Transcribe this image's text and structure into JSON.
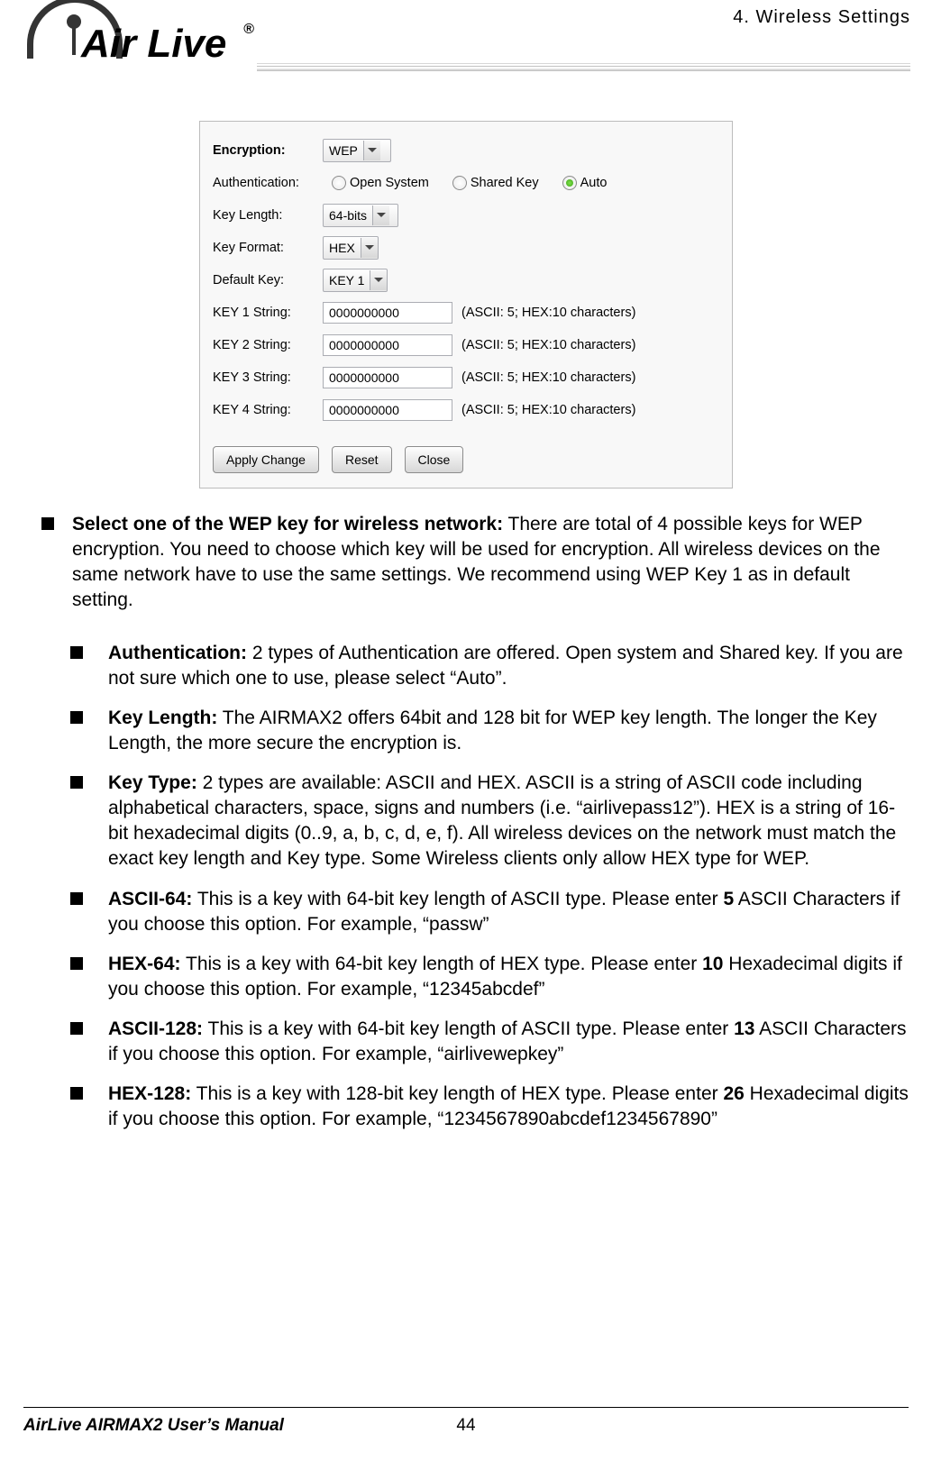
{
  "header": {
    "chapter": "4.  Wireless  Settings",
    "brand": "Air Live",
    "reg": "®"
  },
  "panel": {
    "encryption_label": "Encryption:",
    "encryption_value": "WEP",
    "auth_label": "Authentication:",
    "auth_open": "Open System",
    "auth_shared": "Shared Key",
    "auth_auto": "Auto",
    "keylen_label": "Key Length:",
    "keylen_value": "64-bits",
    "keyfmt_label": "Key Format:",
    "keyfmt_value": "HEX",
    "defkey_label": "Default Key:",
    "defkey_value": "KEY 1",
    "key_string_labels": [
      "KEY 1 String:",
      "KEY 2 String:",
      "KEY 3 String:",
      "KEY 4 String:"
    ],
    "key_value": "0000000000",
    "key_hint": "(ASCII: 5; HEX:10 characters)",
    "btn_apply": "Apply Change",
    "btn_reset": "Reset",
    "btn_close": "Close"
  },
  "body": {
    "main_bold": "Select one of the WEP key for wireless network:",
    "main_text": "   There are total of 4 possible keys for WEP encryption.   You need to choose which key will be used for encryption.   All wireless devices on the same network have to use the same settings.   We recommend using WEP Key 1 as in default setting.",
    "items": [
      {
        "bold": "Authentication:",
        "text": "   2 types of Authentication are offered.   Open system and Shared key.   If you are not sure which one to use, please select “Auto”."
      },
      {
        "bold": "Key Length:",
        "text": "   The AIRMAX2 offers 64bit and 128 bit for WEP key length.   The longer the Key Length, the more secure the encryption is."
      },
      {
        "bold": "Key Type:",
        "text": "   2 types are available: ASCII and HEX.   ASCII is a string of ASCII code including alphabetical characters, space, signs and numbers (i.e. “airlivepass12”).   HEX is a string of 16-bit hexadecimal digits (0..9, a, b, c, d, e, f).   All wireless devices on the network must match the exact key length and Key type.   Some Wireless clients only allow HEX type for WEP."
      },
      {
        "bold": "ASCII-64:",
        "text": " This is a key with 64-bit key length of ASCII type.   Please enter ",
        "num": "5",
        "tail": " ASCII Characters if you choose this option. For example, “passw”"
      },
      {
        "bold": "HEX-64:",
        "text": " This is a key with 64-bit key length of HEX type.   Please enter ",
        "num": "10",
        "tail": " Hexadecimal digits if you choose this option. For example, “12345abcdef”"
      },
      {
        "bold": "ASCII-128:",
        "text": " This is a key with 64-bit key length of ASCII type.   Please enter ",
        "num": "13",
        "tail": " ASCII Characters if you choose this option. For example, “airlivewepkey”"
      },
      {
        "bold": "HEX-128:",
        "text": " This is a key with 128-bit key length of HEX type.   Please enter ",
        "num": "26",
        "tail": " Hexadecimal digits if you choose this option. For example, “1234567890abcdef1234567890”"
      }
    ]
  },
  "footer": {
    "left": "AirLive AIRMAX2 User’s Manual",
    "page": "44"
  }
}
